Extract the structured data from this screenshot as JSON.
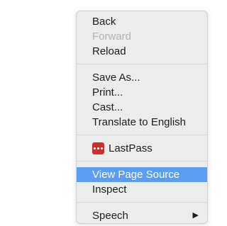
{
  "context_menu": {
    "group1": [
      {
        "label": "Back",
        "enabled": true
      },
      {
        "label": "Forward",
        "enabled": false
      },
      {
        "label": "Reload",
        "enabled": true
      }
    ],
    "group2": [
      {
        "label": "Save As..."
      },
      {
        "label": "Print..."
      },
      {
        "label": "Cast..."
      },
      {
        "label": "Translate to English"
      }
    ],
    "group3": [
      {
        "label": "LastPass",
        "icon": "lastpass-icon",
        "icon_color": "#c8312c"
      }
    ],
    "group4": [
      {
        "label": "View Page Source",
        "highlighted": true
      },
      {
        "label": "Inspect"
      }
    ],
    "group5": [
      {
        "label": "Speech",
        "has_submenu": true,
        "submenu_glyph": "▶"
      }
    ]
  },
  "colors": {
    "menu_background": "#ececec",
    "highlight": "#5b9ef1",
    "disabled_text": "#b4b4b4",
    "lastpass_red": "#c8312c"
  }
}
